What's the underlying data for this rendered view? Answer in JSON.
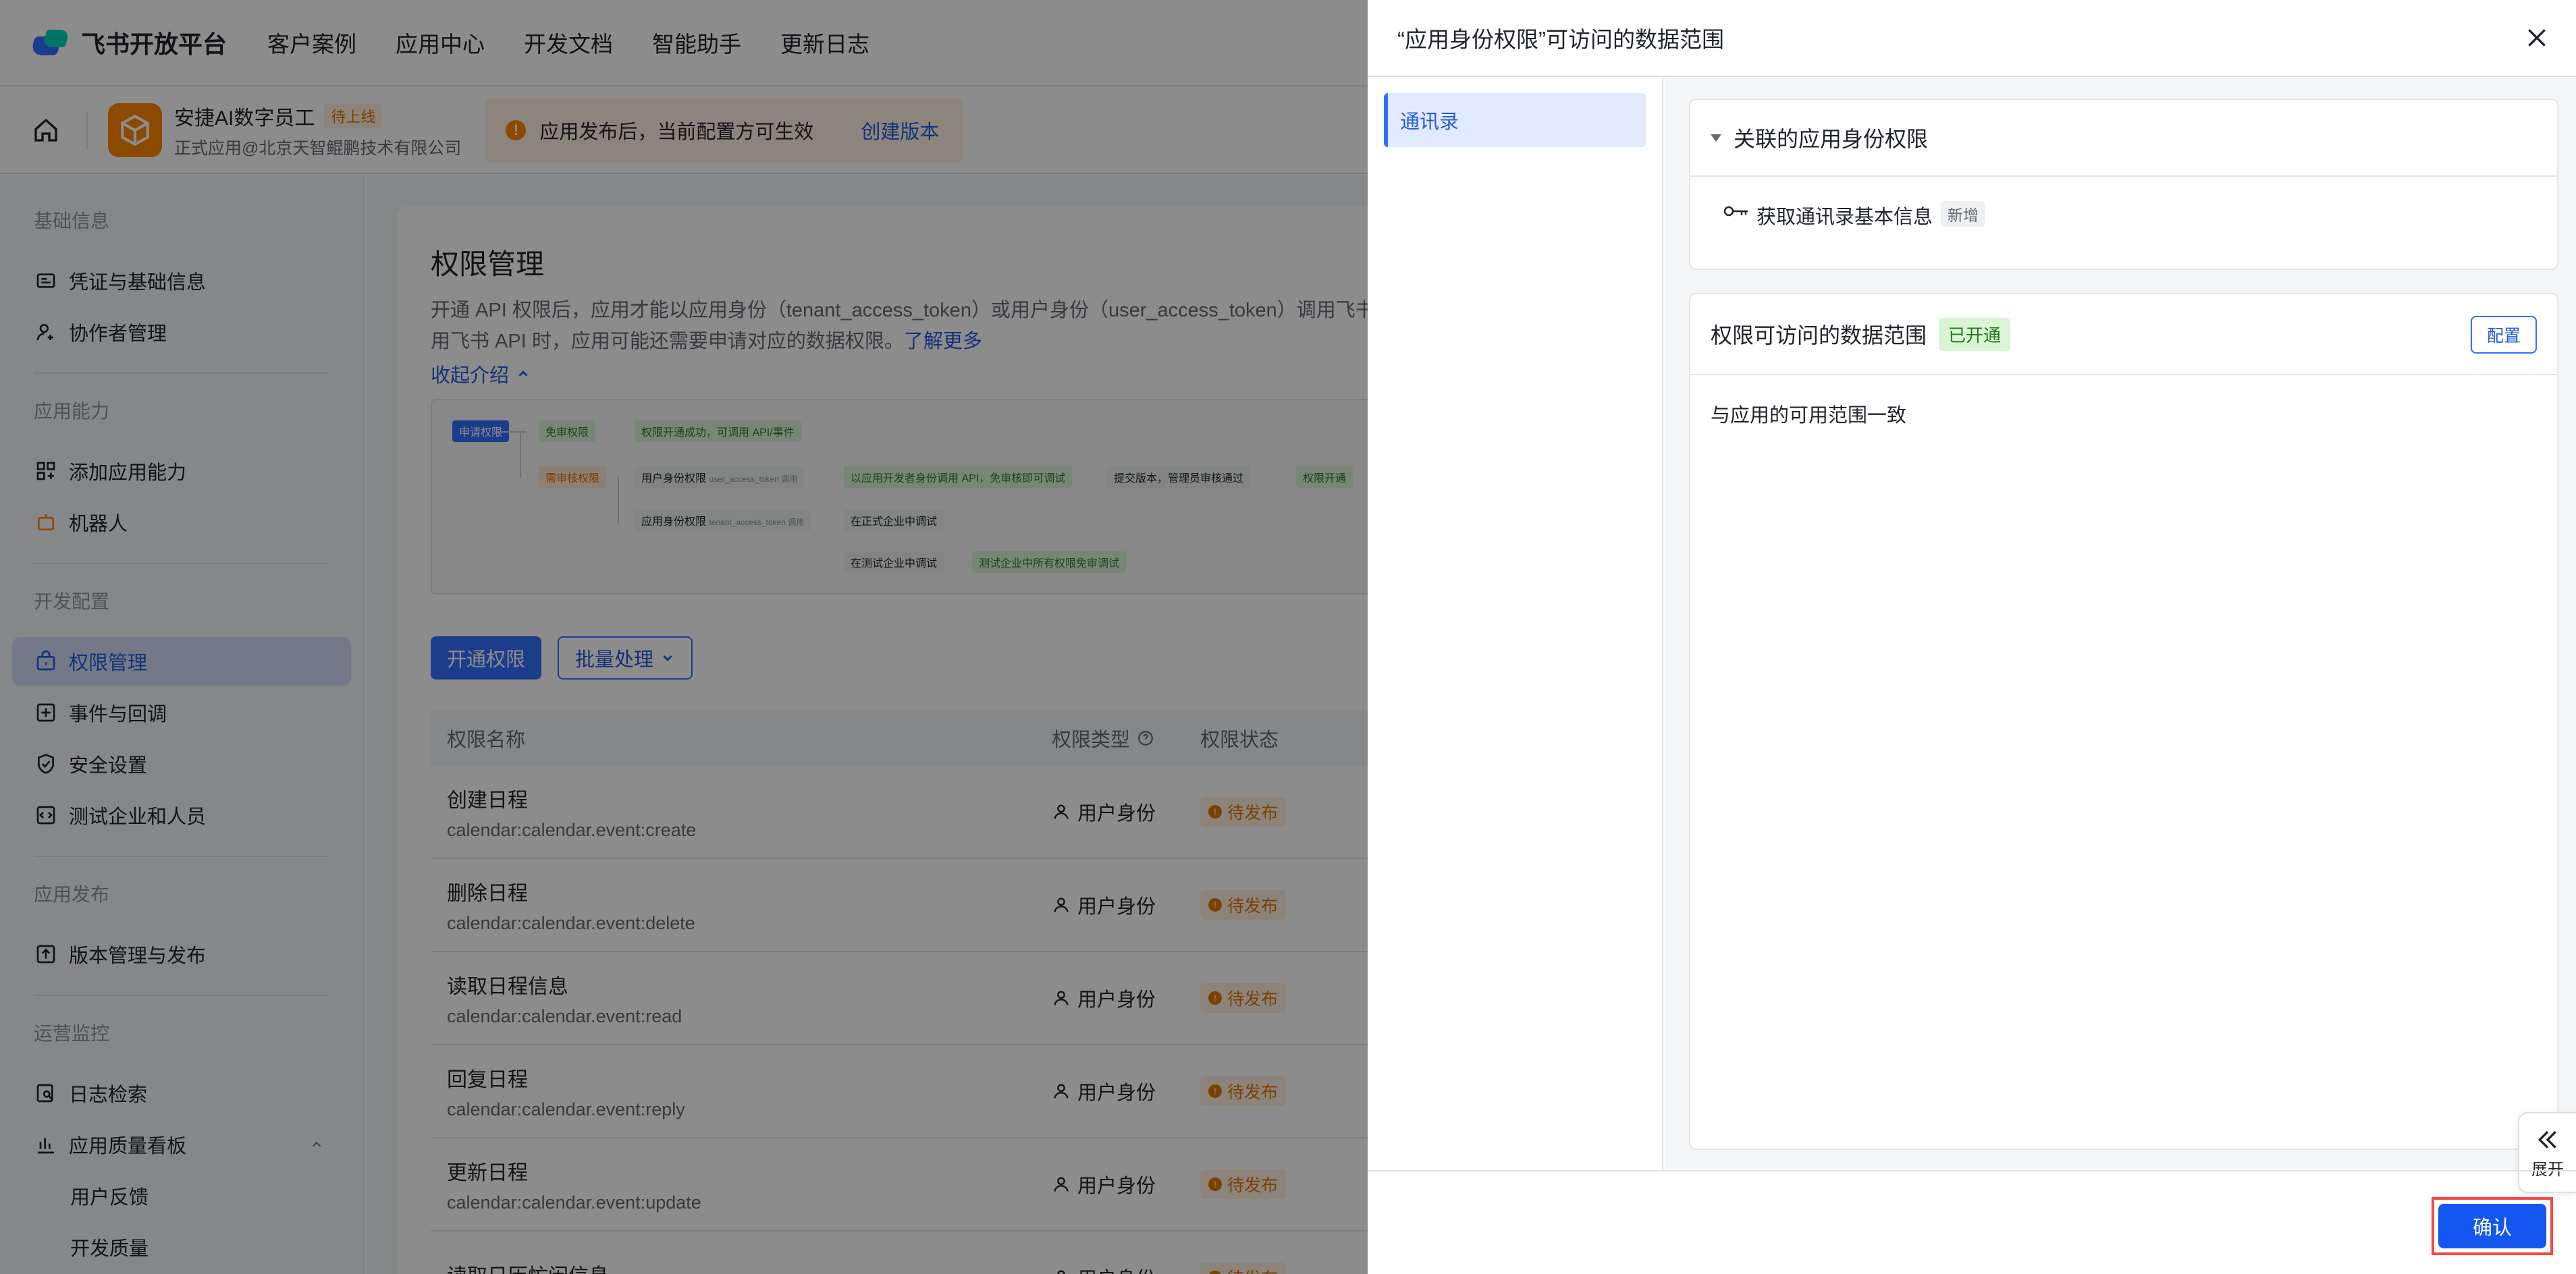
{
  "topnav": {
    "logo_text": "飞书开放平台",
    "items": [
      "客户案例",
      "应用中心",
      "开发文档",
      "智能助手",
      "更新日志"
    ]
  },
  "app": {
    "name": "安捷AI数字员工",
    "status_tag": "待上线",
    "subtitle": "正式应用@北京天智鲲鹏技术有限公司",
    "notice": "应用发布后，当前配置方可生效",
    "notice_link": "创建版本"
  },
  "sidebar": {
    "groups": [
      {
        "title": "基础信息",
        "items": [
          {
            "label": "凭证与基础信息",
            "icon": "id-card-icon"
          },
          {
            "label": "协作者管理",
            "icon": "user-add-icon"
          }
        ]
      },
      {
        "title": "应用能力",
        "items": [
          {
            "label": "添加应用能力",
            "icon": "grid-add-icon"
          },
          {
            "label": "机器人",
            "icon": "robot-icon"
          }
        ]
      },
      {
        "title": "开发配置",
        "items": [
          {
            "label": "权限管理",
            "icon": "permission-icon"
          },
          {
            "label": "事件与回调",
            "icon": "event-icon"
          },
          {
            "label": "安全设置",
            "icon": "shield-icon"
          },
          {
            "label": "测试企业和人员",
            "icon": "code-icon"
          }
        ]
      },
      {
        "title": "应用发布",
        "items": [
          {
            "label": "版本管理与发布",
            "icon": "upload-icon"
          }
        ]
      },
      {
        "title": "运营监控",
        "items": [
          {
            "label": "日志检索",
            "icon": "log-search-icon"
          },
          {
            "label": "应用质量看板",
            "icon": "chart-icon"
          },
          {
            "label": "用户反馈"
          },
          {
            "label": "开发质量"
          }
        ]
      }
    ]
  },
  "main": {
    "title": "权限管理",
    "desc_line1": "开通 API 权限后，应用才能以应用身份（tenant_access_token）或用户身份（user_access_token）调用飞书 API",
    "desc_line2": "用飞书 API 时，应用可能还需要申请对应的数据权限。",
    "learn_more": "了解更多",
    "collapse": "收起介绍",
    "flow": {
      "apply": "申请权限",
      "no_review": "免审权限",
      "enabled": "权限开通成功，可调用 API/事件",
      "need_review": "需审核权限",
      "user_identity": "用户身份权限",
      "user_token": "user_access_token 调用",
      "dev_call": "以应用开发者身份调用 API，免审核即可调试",
      "submit": "提交版本，管理员审核通过",
      "enabled_short": "权限开通",
      "app_identity": "应用身份权限",
      "tenant_token": "tenant_access_token 调用",
      "prod_debug": "在正式企业中调试",
      "test_debug": "在测试企业中调试",
      "test_all": "测试企业中所有权限免审调试"
    },
    "btn_enable": "开通权限",
    "btn_batch": "批量处理",
    "table": {
      "headers": [
        "权限名称",
        "权限类型",
        "权限状态"
      ],
      "rows": [
        {
          "name": "创建日程",
          "code": "calendar:calendar.event:create",
          "type": "用户身份",
          "status": "待发布"
        },
        {
          "name": "删除日程",
          "code": "calendar:calendar.event:delete",
          "type": "用户身份",
          "status": "待发布"
        },
        {
          "name": "读取日程信息",
          "code": "calendar:calendar.event:read",
          "type": "用户身份",
          "status": "待发布"
        },
        {
          "name": "回复日程",
          "code": "calendar:calendar.event:reply",
          "type": "用户身份",
          "status": "待发布"
        },
        {
          "name": "更新日程",
          "code": "calendar:calendar.event:update",
          "type": "用户身份",
          "status": "待发布"
        },
        {
          "name": "读取日历忙闲信息",
          "code": "",
          "type": "用户身份",
          "status": "待发布"
        }
      ]
    }
  },
  "drawer": {
    "title": "“应用身份权限”可访问的数据范围",
    "nav_item": "通讯录",
    "panel1_title": "关联的应用身份权限",
    "perm_item": "获取通讯录基本信息",
    "perm_tag": "新增",
    "panel2_title": "权限可访问的数据范围",
    "panel2_tag": "已开通",
    "config_btn": "配置",
    "scope_text": "与应用的可用范围一致",
    "expand_label": "展开",
    "confirm": "确认"
  },
  "colors": {
    "primary": "#3370ff",
    "confirm": "#1456f0",
    "highlight_border": "#f54a45",
    "pending": "#de7802",
    "enabled": "#237b19"
  }
}
